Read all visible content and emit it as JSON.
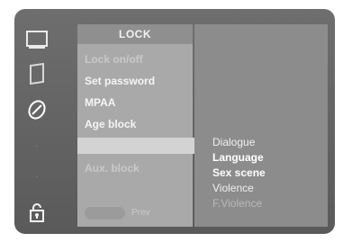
{
  "sidebar": {
    "icons": [
      "screen-icon",
      "picture-icon",
      "sound-icon",
      "time-icon",
      "special-icon",
      "lock-icon"
    ]
  },
  "submenu": {
    "title": "LOCK",
    "items": [
      {
        "label": "Lock on/off"
      },
      {
        "label": "Set password"
      },
      {
        "label": "MPAA"
      },
      {
        "label": "Age block"
      },
      {
        "label": "Aux. block"
      }
    ],
    "prev_label": "Prev"
  },
  "options": {
    "items": [
      {
        "label": "Dialogue"
      },
      {
        "label": "Language"
      },
      {
        "label": "Sex scene"
      },
      {
        "label": "Violence"
      },
      {
        "label": "F.Violence"
      }
    ]
  }
}
